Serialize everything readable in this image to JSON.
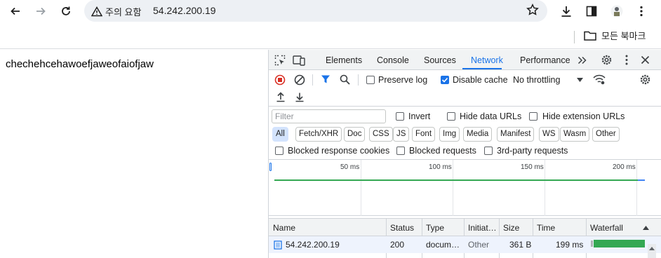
{
  "browser": {
    "security_label": "주의 요함",
    "url": "54.242.200.19",
    "bookmarks_all": "모든 북마크"
  },
  "page": {
    "text": "chechehcehawoefjaweofaiofjaw"
  },
  "devtools": {
    "tabs": [
      "Elements",
      "Console",
      "Sources",
      "Network",
      "Performance"
    ],
    "active_tab": "Network",
    "preserve_log": "Preserve log",
    "disable_cache": "Disable cache",
    "throttling": "No throttling",
    "filter_placeholder": "Filter",
    "invert": "Invert",
    "hide_data_urls": "Hide data URLs",
    "hide_extension_urls": "Hide extension URLs",
    "type_chips": [
      "All",
      "Fetch/XHR",
      "Doc",
      "CSS",
      "JS",
      "Font",
      "Img",
      "Media",
      "Manifest",
      "WS",
      "Wasm",
      "Other"
    ],
    "blocked_response_cookies": "Blocked response cookies",
    "blocked_requests": "Blocked requests",
    "third_party_requests": "3rd-party requests",
    "timeline_ticks": [
      "50 ms",
      "100 ms",
      "150 ms",
      "200 ms"
    ],
    "columns": [
      "Name",
      "Status",
      "Type",
      "Initiat…",
      "Size",
      "Time",
      "Waterfall"
    ],
    "rows": [
      {
        "name": "54.242.200.19",
        "status": "200",
        "type": "docum…",
        "initiator": "Other",
        "size": "361 B",
        "time": "199 ms"
      }
    ],
    "colors": {
      "accent": "#1a73e8",
      "record": "#d93025",
      "waterfall": "#34a853"
    }
  }
}
